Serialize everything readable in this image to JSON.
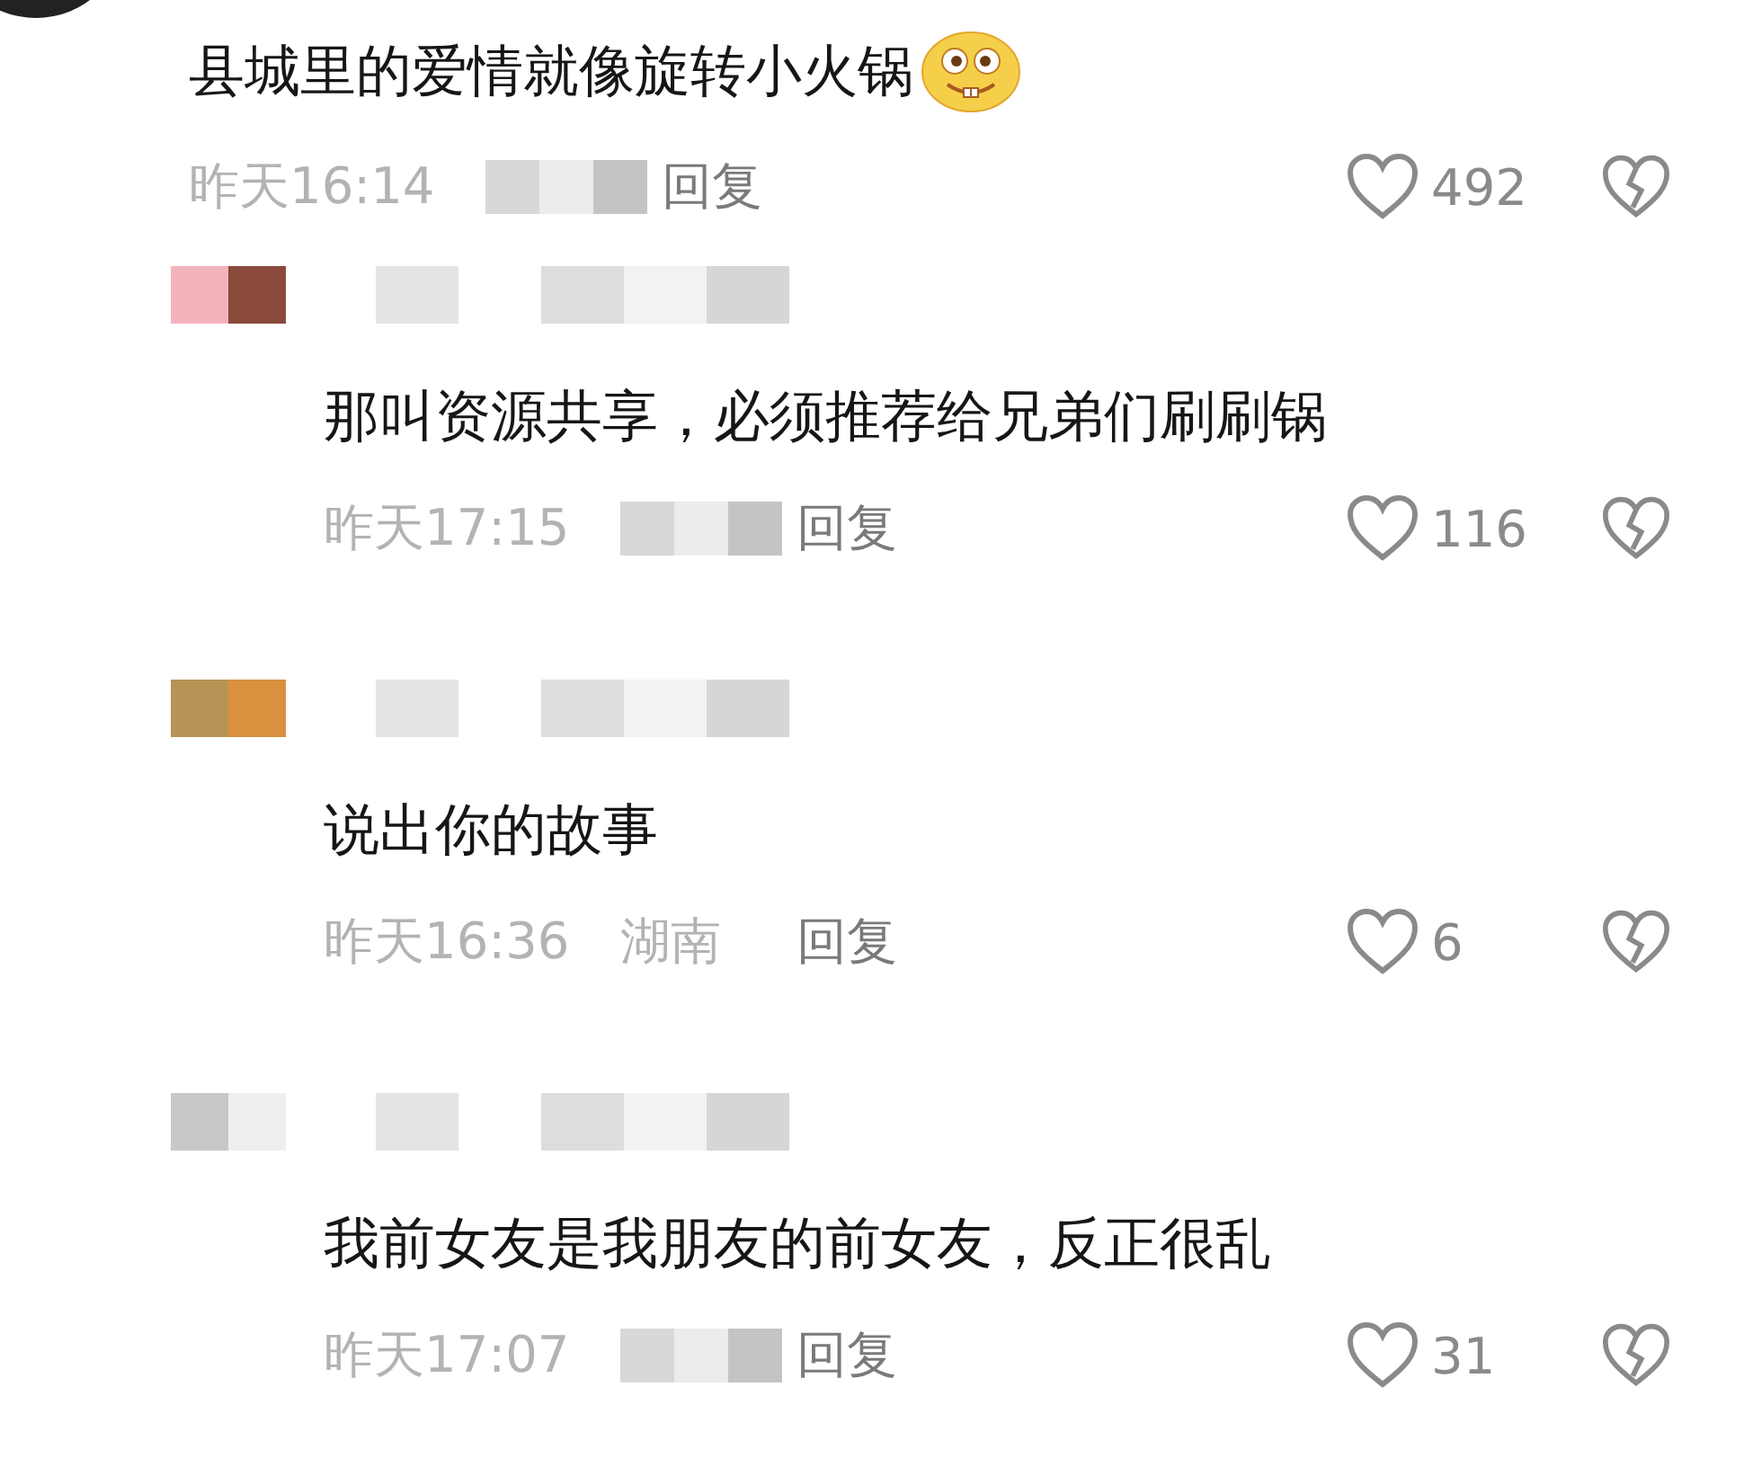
{
  "comments": [
    {
      "kind": "top",
      "text": "县城里的爱情就像旋转小火锅",
      "emoji": true,
      "time": "昨天16:14",
      "location_hidden": true,
      "reply": "回复",
      "likes": "492"
    },
    {
      "kind": "reply",
      "text": "那叫资源共享，必须推荐给兄弟们刷刷锅",
      "emoji": false,
      "time": "昨天17:15",
      "location_hidden": true,
      "reply": "回复",
      "likes": "116"
    },
    {
      "kind": "reply",
      "text": "说出你的故事",
      "emoji": false,
      "time": "昨天16:36",
      "location": "湖南",
      "reply": "回复",
      "likes": "6"
    },
    {
      "kind": "reply",
      "text": "我前女友是我朋友的前女友，反正很乱",
      "emoji": false,
      "time": "昨天17:07",
      "location_hidden": true,
      "reply": "回复",
      "likes": "31"
    }
  ]
}
